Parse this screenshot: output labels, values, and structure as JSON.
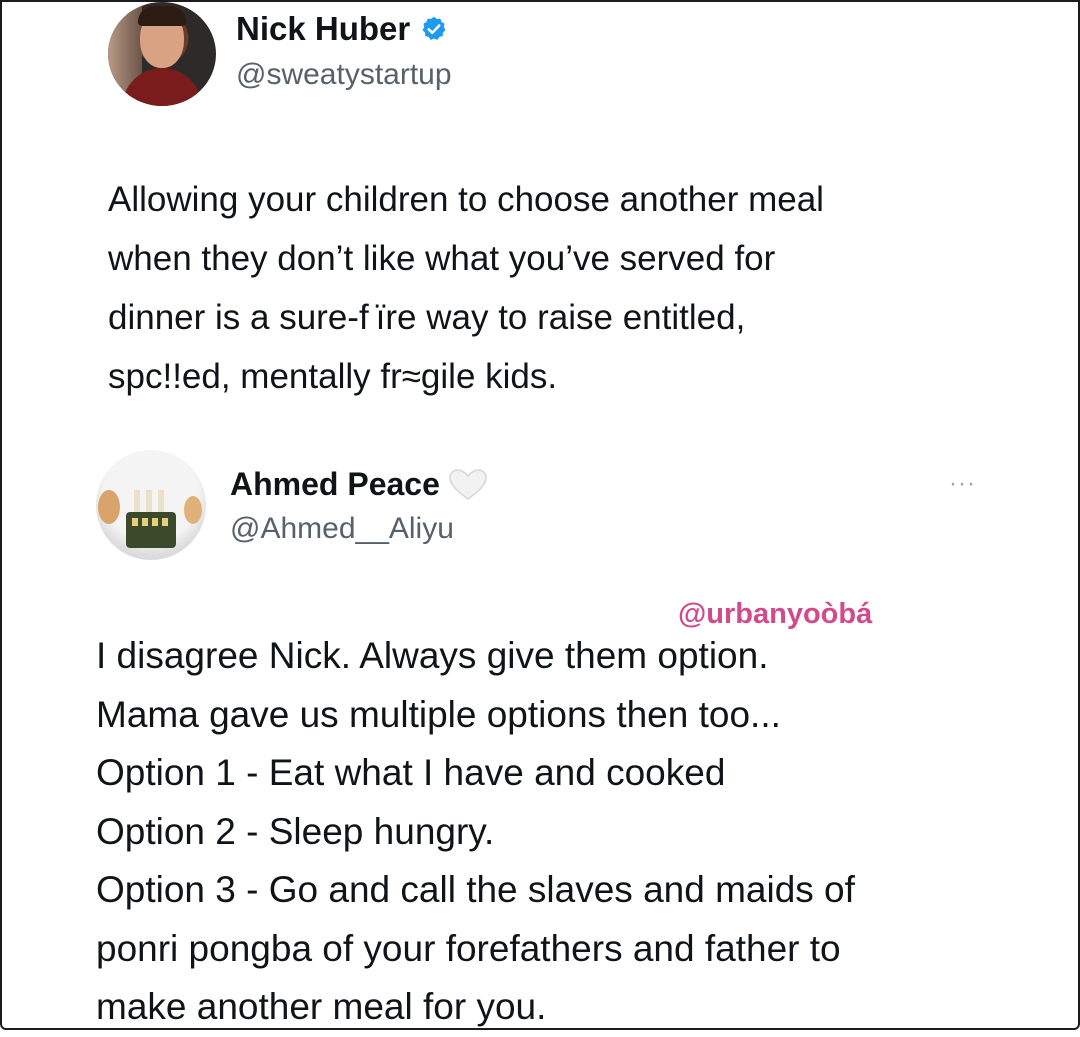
{
  "tweet1": {
    "author_name": "Nick Huber",
    "author_handle": "@sweatystartup",
    "verified_icon": "verified-badge-icon",
    "verified_color": "#1d9bf0",
    "text_lines": [
      "Allowing your children to choose another meal",
      "when they don’t like what you’ve served for",
      "dinner is a sure-f ïre way to raise entitled,",
      "spc!!ed, mentally fr≈gile kids."
    ]
  },
  "tweet2": {
    "author_name": "Ahmed Peace",
    "author_handle": "@Ahmed__Aliyu",
    "heart_icon": "white-heart-icon",
    "more_label": "···",
    "watermark": "@urbanyoòbá",
    "watermark_color": "#d24a8c",
    "text_lines": [
      "I disagree Nick. Always give them option.",
      "Mama gave us multiple options then too...",
      "Option 1 - Eat what I have and cooked",
      "Option 2 - Sleep hungry.",
      "Option 3 - Go and call the slaves and maids of",
      "ponri pongba of your forefathers and father to",
      "make another meal for you."
    ]
  }
}
